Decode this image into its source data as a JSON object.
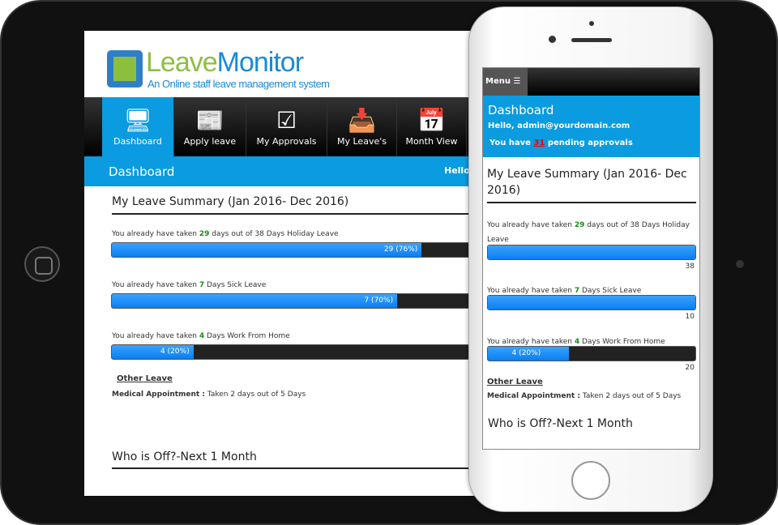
{
  "logo": {
    "title_a": "Leave",
    "title_b": "Monitor",
    "tagline": "An Online staff leave management system"
  },
  "nav": {
    "tabs": [
      {
        "label": "Dashboard",
        "icon": "monitor-icon",
        "active": true
      },
      {
        "label": "Apply leave",
        "icon": "newspaper-icon"
      },
      {
        "label": "My Approvals",
        "icon": "checkbox-icon"
      },
      {
        "label": "My Leave's",
        "icon": "inbox-icon"
      },
      {
        "label": "Month View",
        "icon": "calendar-icon"
      }
    ]
  },
  "header": {
    "title": "Dashboard",
    "greeting_short": "Hello,",
    "greeting": "Hello, admin@yourdomain.com",
    "pending_prefix": "You have ",
    "pending_count": "31",
    "pending_suffix": " pending  approvals"
  },
  "summary": {
    "title": "My Leave Summary (Jan 2016- Dec 2016)",
    "items": [
      {
        "pre": "You already have taken ",
        "num": "29",
        "post": " days out of 38 Days Holiday Leave",
        "bar_label": "29 (76%)",
        "percent": 76,
        "total": "38",
        "phone_fill_percent": 100
      },
      {
        "pre": "You already have taken ",
        "num": "7",
        "post": " Days Sick Leave",
        "bar_label": "7 (70%)",
        "percent": 70,
        "total": "10",
        "phone_fill_percent": 100
      },
      {
        "pre": "You already have taken ",
        "num": "4",
        "post": " Days Work From Home",
        "bar_label": "4 (20%)",
        "percent": 20,
        "total": "20",
        "phone_fill_percent": 39
      }
    ]
  },
  "other": {
    "title": "Other Leave",
    "label": "Medical Appointment :",
    "value": " Taken 2 days out of 5 Days"
  },
  "whos_off": {
    "title": "Who is Off?-Next 1 Month"
  },
  "phone": {
    "menu_label": "Menu",
    "menu_icon": "hamburger-icon"
  },
  "colors": {
    "accent": "#0a9be0",
    "bar": "#0a7ef0",
    "highlight": "#1a8a1a",
    "pending": "#e00000"
  }
}
